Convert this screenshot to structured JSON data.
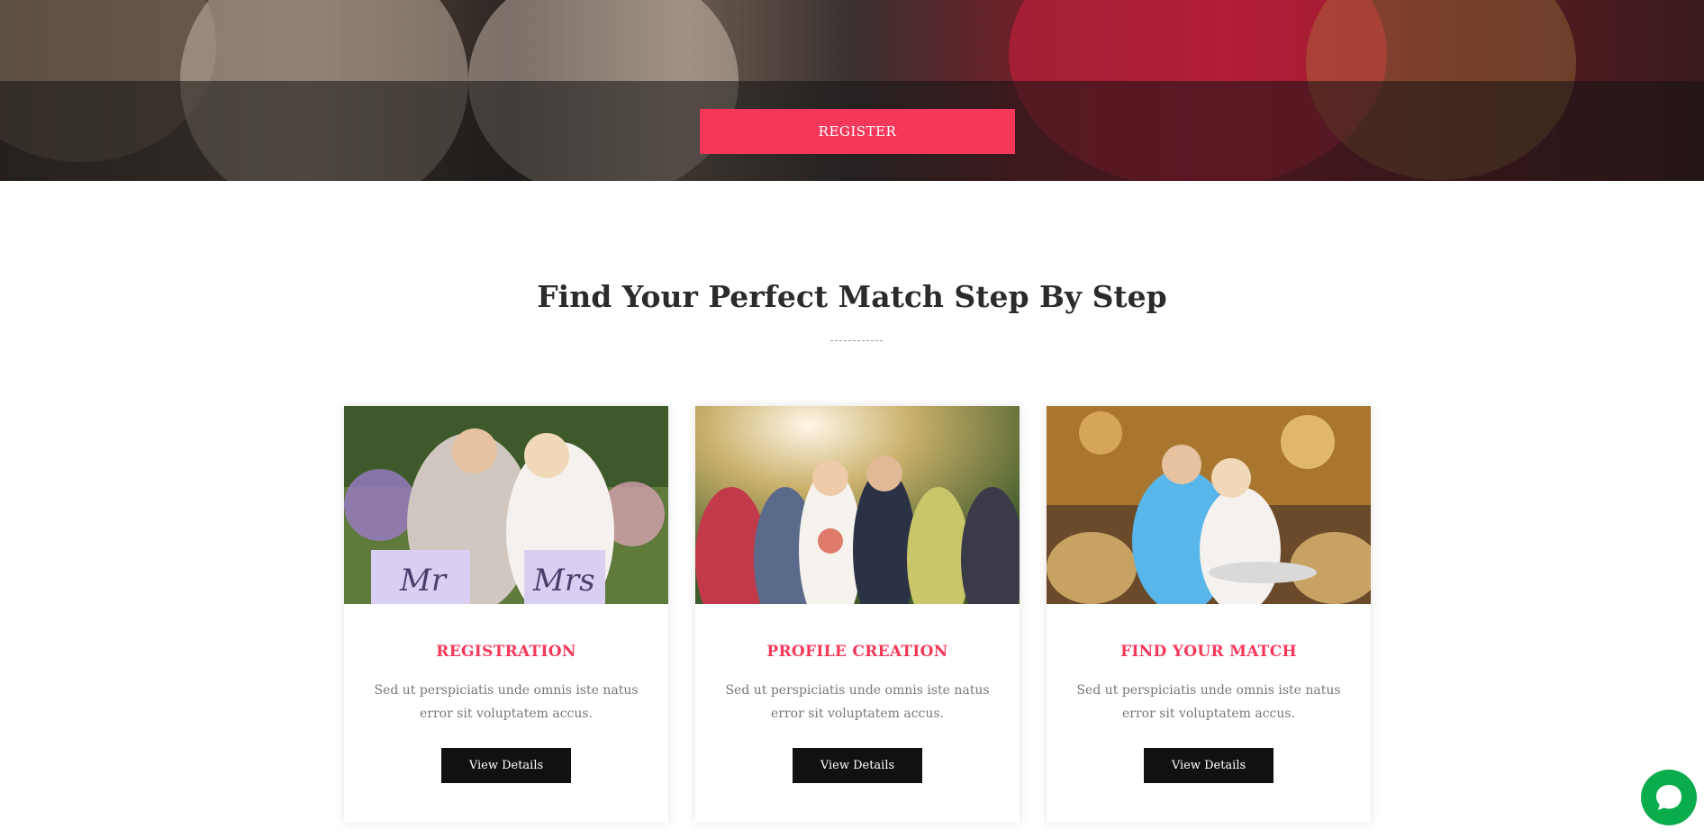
{
  "hero": {
    "register_label": "REGISTER"
  },
  "section": {
    "title": "Find Your Perfect Match Step By Step"
  },
  "cards": [
    {
      "title": "REGISTRATION",
      "text": "Sed ut perspiciatis unde omnis iste natus error sit voluptatem accus.",
      "button_label": "View Details",
      "image_text_left": "Mr",
      "image_text_right": "Mrs"
    },
    {
      "title": "PROFILE CREATION",
      "text": "Sed ut perspiciatis unde omnis iste natus error sit voluptatem accus.",
      "button_label": "View Details"
    },
    {
      "title": "FIND YOUR MATCH",
      "text": "Sed ut perspiciatis unde omnis iste natus error sit voluptatem accus.",
      "button_label": "View Details"
    }
  ],
  "colors": {
    "accent": "#f5385a",
    "button_dark": "#111111",
    "chat_green": "#0bac4c",
    "title_text": "#2b2b2b",
    "body_text": "#777777"
  },
  "icons": {
    "chat": "chat-bubble-icon"
  }
}
